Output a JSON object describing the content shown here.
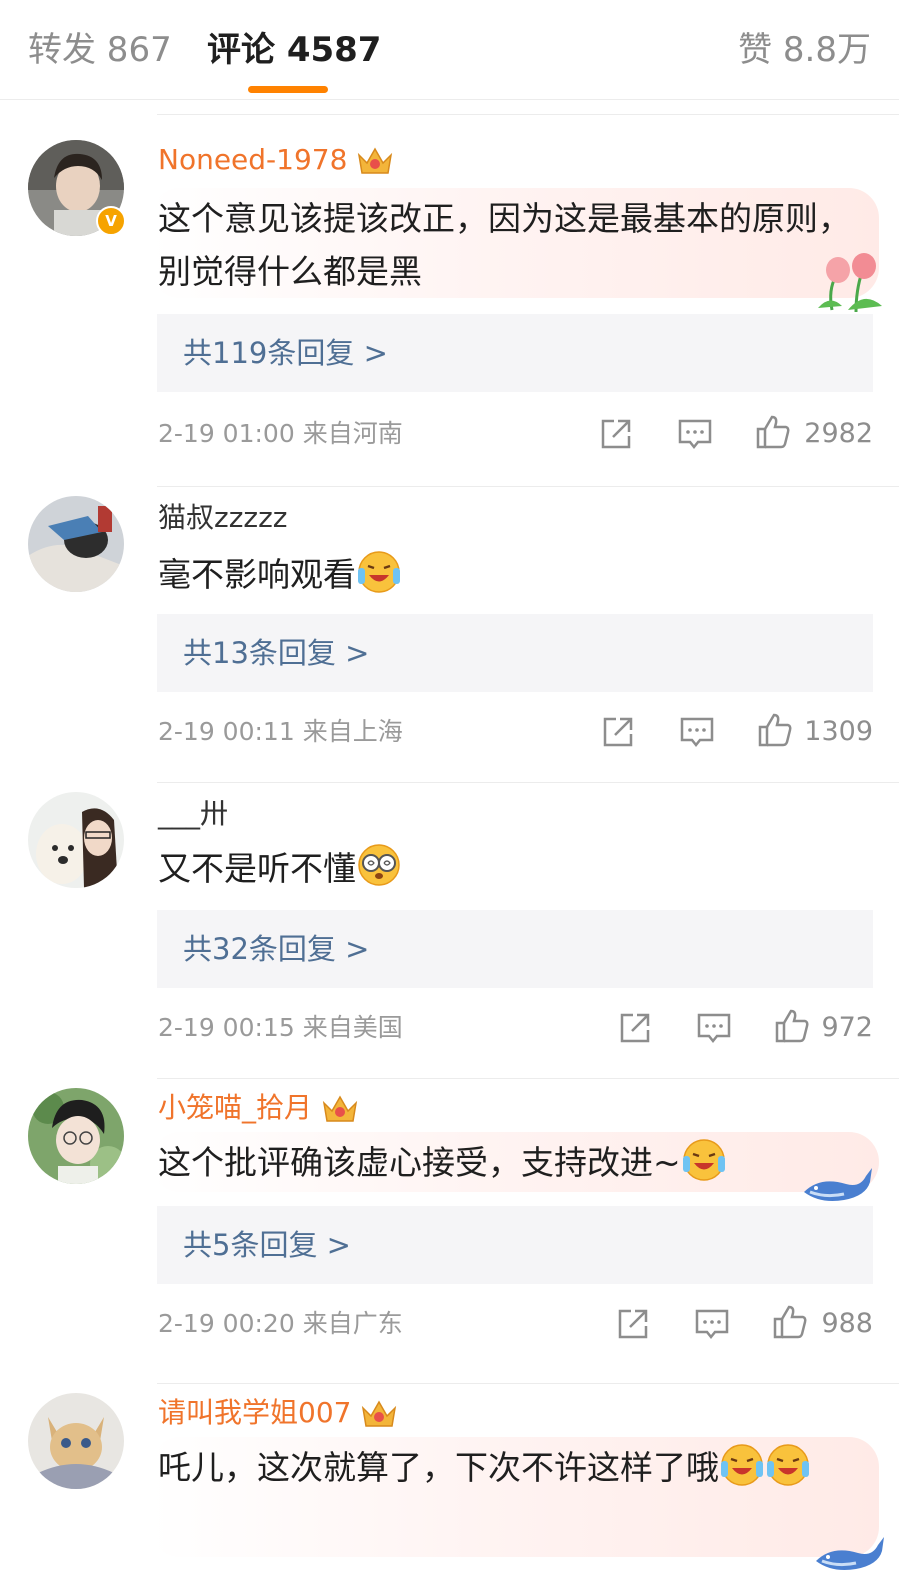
{
  "tabs": {
    "repost": "转发 867",
    "comment": "评论 4587",
    "like": "赞 8.8万"
  },
  "comments": [
    {
      "user": "Noneed-1978",
      "text": "这个意见该提该改正，因为这是最基本的原则，别觉得什么都是黑",
      "replies": "共119条回复 >",
      "time": "2-19 01:00",
      "location": "来自河南",
      "likes": "2982"
    },
    {
      "user": "猫叔zzzzz",
      "text": "毫不影响观看",
      "replies": "共13条回复 >",
      "time": "2-19 00:11",
      "location": "来自上海",
      "likes": "1309"
    },
    {
      "user": "___卅",
      "text": "又不是听不懂",
      "replies": "共32条回复 >",
      "time": "2-19 00:15",
      "location": "来自美国",
      "likes": "972"
    },
    {
      "user": "小笼喵_拾月",
      "text": "这个批评确该虚心接受，支持改进~",
      "replies": "共5条回复 >",
      "time": "2-19 00:20",
      "location": "来自广东",
      "likes": "988"
    },
    {
      "user": "请叫我学姐007",
      "text": "吒儿，这次就算了，下次不许这样了哦",
      "likes": ""
    }
  ],
  "icons": {
    "share": "share-icon",
    "reply": "comment-icon",
    "like": "thumbs-up-icon",
    "crown": "crown-badge-icon",
    "verified": "verified-v-icon"
  },
  "colors": {
    "accent": "#ff8200",
    "vip_name": "#f0742b",
    "reply_link": "#4f6f94",
    "meta": "#9a9a9a"
  }
}
